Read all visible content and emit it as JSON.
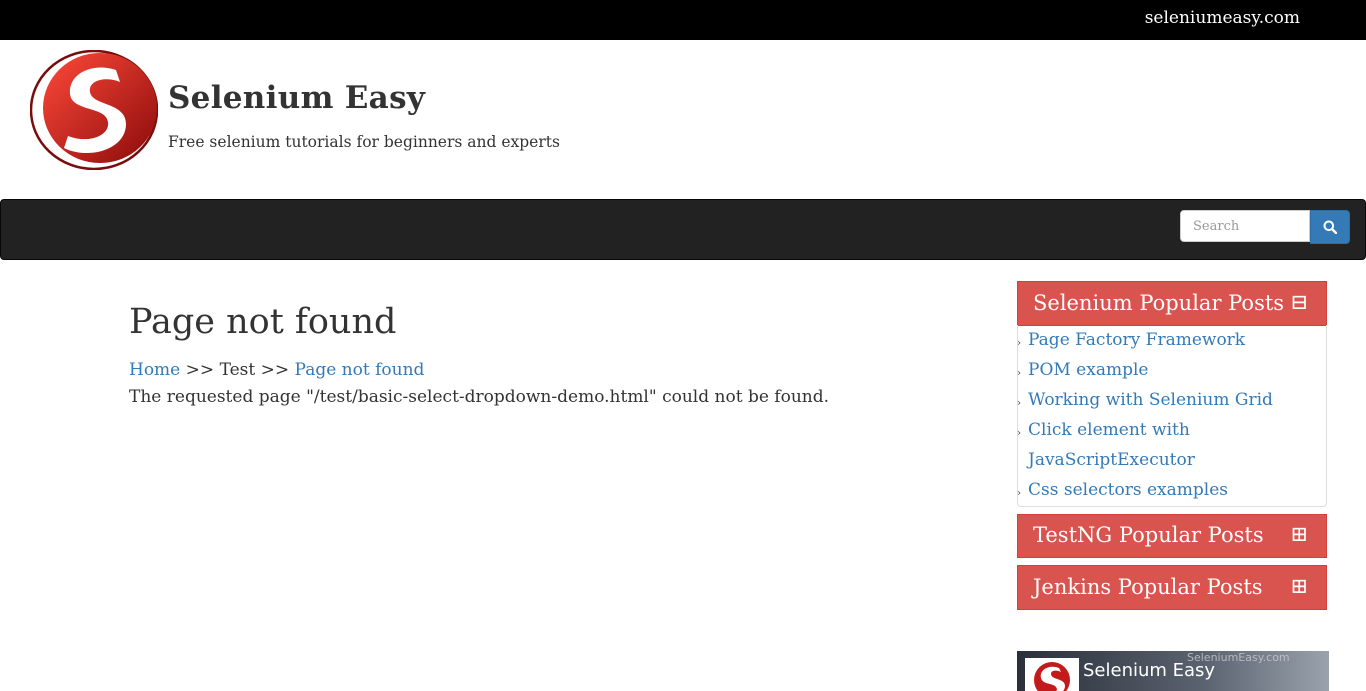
{
  "topbar": {
    "site_link": "seleniumeasy.com"
  },
  "brand": {
    "title": "Selenium Easy",
    "tagline": "Free selenium tutorials for beginners and experts",
    "logo_icon": "selenium-easy-logo-icon"
  },
  "search": {
    "placeholder": "Search",
    "button_icon": "search-icon"
  },
  "main": {
    "title": "Page not found",
    "breadcrumb": {
      "home": "Home",
      "sep1": ">>",
      "middle": "Test",
      "sep2": ">>",
      "current": "Page not found"
    },
    "message": "The requested page \"/test/basic-select-dropdown-demo.html\" could not be found."
  },
  "sidebar": {
    "panels": [
      {
        "title": "Selenium Popular Posts",
        "toggle": "⊟",
        "expanded": true,
        "items": [
          "Page Factory Framework",
          "POM example",
          "Working with Selenium Grid",
          "Click element with",
          "JavaScriptExecutor",
          "Css selectors examples"
        ]
      },
      {
        "title": "TestNG Popular Posts",
        "toggle": "⊞",
        "expanded": false
      },
      {
        "title": "Jenkins Popular Posts",
        "toggle": "⊞",
        "expanded": false
      }
    ],
    "video": {
      "title": "Selenium Easy",
      "watermark": "SeleniumEasy.com"
    }
  },
  "colors": {
    "accent": "#d9534f",
    "link": "#337ab7",
    "navbar": "#222222",
    "topbar": "#000000"
  }
}
